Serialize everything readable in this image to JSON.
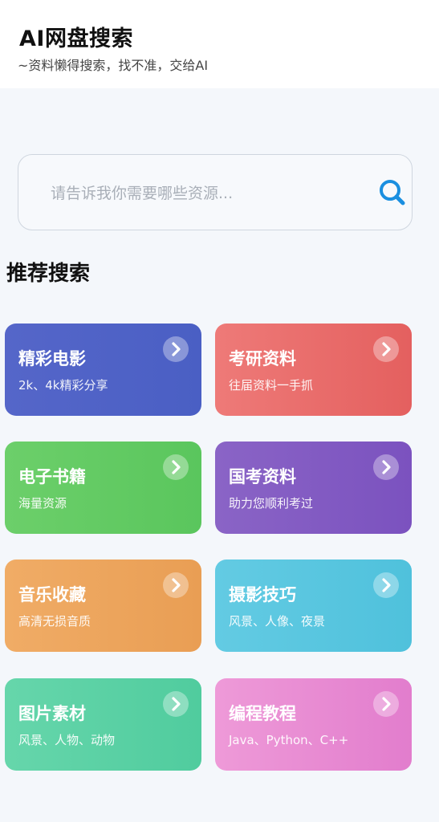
{
  "header": {
    "title": "AI网盘搜索",
    "subtitle": "~资料懒得搜索，找不准，交给AI"
  },
  "search": {
    "placeholder": "请告诉我你需要哪些资源...",
    "value": ""
  },
  "section": {
    "title": "推荐搜索"
  },
  "cards": [
    {
      "title": "精彩电影",
      "desc": "2k、4k精彩分享",
      "color_from": "#5566c9",
      "color_to": "#4a5fc4",
      "icon": "chevron-right-icon"
    },
    {
      "title": "考研资料",
      "desc": "往届资料一手抓",
      "color_from": "#ee7a78",
      "color_to": "#e4605f",
      "icon": "chevron-right-icon"
    },
    {
      "title": "电子书籍",
      "desc": "海量资源",
      "color_from": "#6ccf6a",
      "color_to": "#5ac65d",
      "icon": "chevron-right-icon"
    },
    {
      "title": "国考资料",
      "desc": "助力您顺利考过",
      "color_from": "#8a64c6",
      "color_to": "#7b52bf",
      "icon": "chevron-right-icon"
    },
    {
      "title": "音乐收藏",
      "desc": "高清无损音质",
      "color_from": "#f0ac66",
      "color_to": "#e99e54",
      "icon": "chevron-right-icon"
    },
    {
      "title": "摄影技巧",
      "desc": "风景、人像、夜景",
      "color_from": "#63cbe3",
      "color_to": "#4fc1dc",
      "icon": "chevron-right-icon"
    },
    {
      "title": "图片素材",
      "desc": "风景、人物、动物",
      "color_from": "#66d6ab",
      "color_to": "#50cc9e",
      "icon": "chevron-right-icon"
    },
    {
      "title": "编程教程",
      "desc": "Java、Python、C++",
      "color_from": "#ee9ad8",
      "color_to": "#e27dcd",
      "icon": "chevron-right-icon"
    }
  ],
  "colors": {
    "accent": "#1a8fe0",
    "background": "#f4f7fb",
    "header_bg": "#ffffff"
  }
}
